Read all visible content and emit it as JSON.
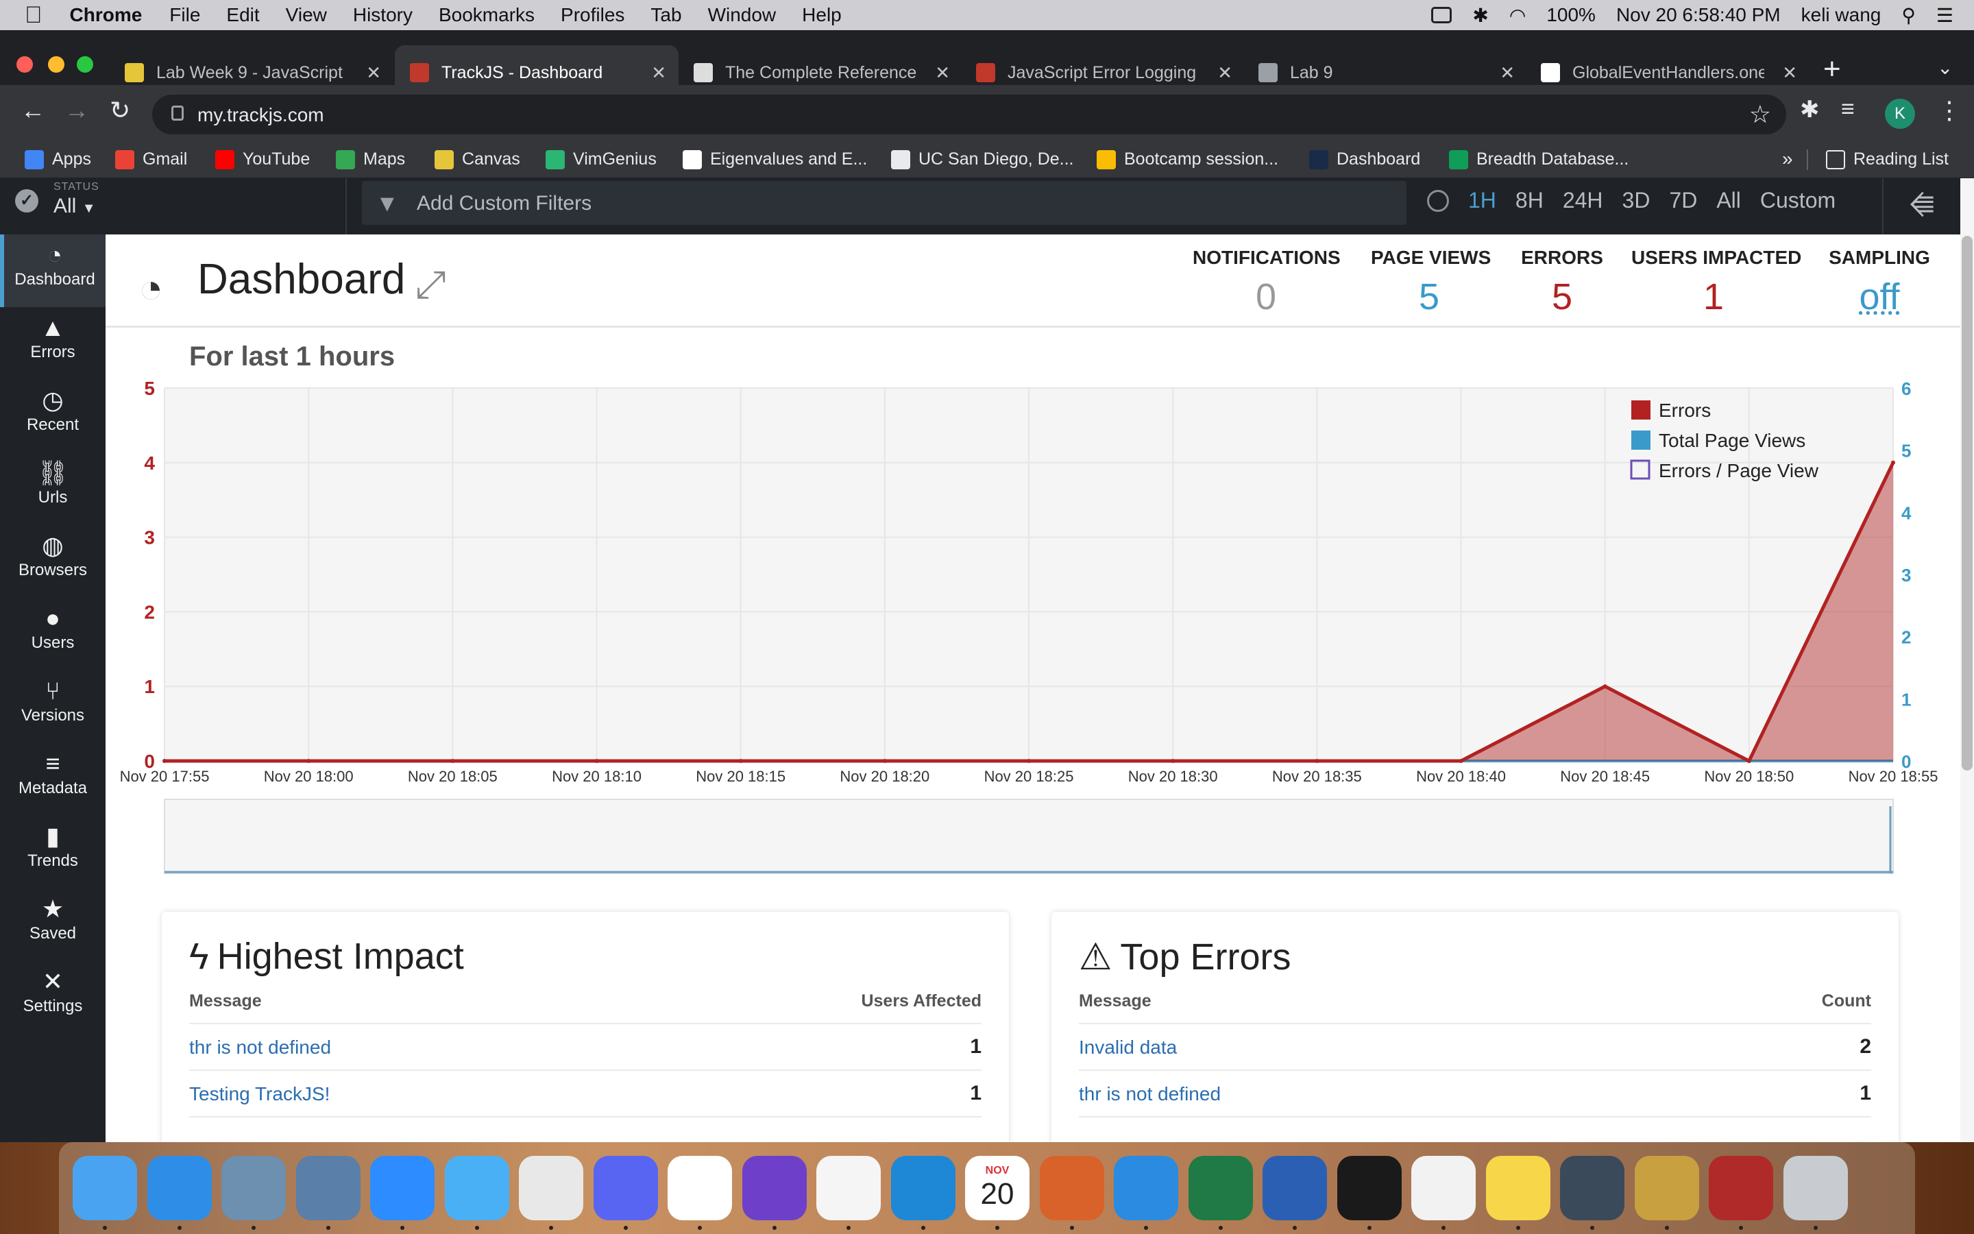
{
  "menubar": {
    "app_name": "Chrome",
    "menus": [
      "File",
      "Edit",
      "View",
      "History",
      "Bookmarks",
      "Profiles",
      "Tab",
      "Window",
      "Help"
    ],
    "battery": "100%",
    "datetime": "Nov 20  6:58:40 PM",
    "user": "keli wang"
  },
  "tabs": [
    {
      "title": "Lab Week 9 - JavaScript",
      "color": "#e5c63a",
      "active": false
    },
    {
      "title": "TrackJS - Dashboard",
      "color": "#c0392b",
      "active": true
    },
    {
      "title": "The Complete Reference",
      "color": "#ddd",
      "active": false
    },
    {
      "title": "JavaScript Error Logging",
      "color": "#c0392b",
      "active": false
    },
    {
      "title": "Lab 9",
      "color": "#9aa0a6",
      "active": false
    },
    {
      "title": "GlobalEventHandlers.one",
      "color": "#fff",
      "active": false
    }
  ],
  "address_bar": {
    "url": "my.trackjs.com"
  },
  "profile_initial": "K",
  "bookmarks": [
    {
      "label": "Apps",
      "color": "#4285f4"
    },
    {
      "label": "Gmail",
      "color": "#ea4335"
    },
    {
      "label": "YouTube",
      "color": "#ff0000"
    },
    {
      "label": "Maps",
      "color": "#34a853"
    },
    {
      "label": "Canvas",
      "color": "#e5c63a"
    },
    {
      "label": "VimGenius",
      "color": "#2bb673"
    },
    {
      "label": "Eigenvalues and E...",
      "color": "#fff"
    },
    {
      "label": "UC San Diego, De...",
      "color": "#e8eaed"
    },
    {
      "label": "Bootcamp session...",
      "color": "#fbbc04"
    },
    {
      "label": "Dashboard",
      "color": "#182b49"
    },
    {
      "label": "Breadth Database...",
      "color": "#0f9d58"
    }
  ],
  "reading_list": "Reading List",
  "filterbar": {
    "status_label": "STATUS",
    "status_value": "All",
    "filter_placeholder": "Add Custom Filters",
    "ranges": [
      "1H",
      "8H",
      "24H",
      "3D",
      "7D",
      "All",
      "Custom"
    ],
    "active_range": "1H"
  },
  "sidebar": [
    {
      "label": "Dashboard",
      "icon": "dashboard-icon",
      "glyph": "◔",
      "active": true
    },
    {
      "label": "Errors",
      "icon": "warning-icon",
      "glyph": "▲",
      "active": false
    },
    {
      "label": "Recent",
      "icon": "clock-icon",
      "glyph": "◷",
      "active": false
    },
    {
      "label": "Urls",
      "icon": "link-icon",
      "glyph": "⛓",
      "active": false
    },
    {
      "label": "Browsers",
      "icon": "globe-icon",
      "glyph": "◍",
      "active": false
    },
    {
      "label": "Users",
      "icon": "users-icon",
      "glyph": "●",
      "active": false
    },
    {
      "label": "Versions",
      "icon": "branch-icon",
      "glyph": "⑂",
      "active": false
    },
    {
      "label": "Metadata",
      "icon": "database-icon",
      "glyph": "≡",
      "active": false
    },
    {
      "label": "Trends",
      "icon": "bar-chart-icon",
      "glyph": "▮",
      "active": false
    },
    {
      "label": "Saved",
      "icon": "star-icon",
      "glyph": "★",
      "active": false
    },
    {
      "label": "Settings",
      "icon": "tools-icon",
      "glyph": "✕",
      "active": false
    }
  ],
  "dashboard": {
    "title": "Dashboard",
    "stats": [
      {
        "label": "NOTIFICATIONS",
        "value": "0",
        "color": "#999999"
      },
      {
        "label": "PAGE VIEWS",
        "value": "5",
        "color": "#3a9ac9"
      },
      {
        "label": "ERRORS",
        "value": "5",
        "color": "#b22222"
      },
      {
        "label": "USERS IMPACTED",
        "value": "1",
        "color": "#b22222"
      },
      {
        "label": "SAMPLING",
        "value": "off",
        "color": "#3a9ac9"
      }
    ],
    "range_label": "For last 1 hours"
  },
  "chart_data": {
    "type": "area",
    "x": [
      "Nov 20 17:55",
      "Nov 20 18:00",
      "Nov 20 18:05",
      "Nov 20 18:10",
      "Nov 20 18:15",
      "Nov 20 18:20",
      "Nov 20 18:25",
      "Nov 20 18:30",
      "Nov 20 18:35",
      "Nov 20 18:40",
      "Nov 20 18:45",
      "Nov 20 18:50",
      "Nov 20 18:55"
    ],
    "x_tick_labels": [
      "Nov 20 17:55",
      "Nov 20 18:00",
      "Nov 20 18:05",
      "Nov 20 18:10",
      "Nov 20 18:15",
      "Nov 20 18:20",
      "Nov 20 18:25",
      "Nov 20 18:30",
      "Nov 20 18:35",
      "Nov 20 18:40",
      "Nov 20 18:45",
      "Nov 20 18:50",
      "Nov 20 18:55"
    ],
    "series": [
      {
        "name": "Errors",
        "axis": "left",
        "color": "#b22222",
        "values": [
          0,
          0,
          0,
          0,
          0,
          0,
          0,
          0,
          0,
          0,
          1,
          0,
          4
        ]
      },
      {
        "name": "Total Page Views",
        "axis": "right",
        "color": "#3a9ac9",
        "values": [
          0,
          0,
          0,
          0,
          0,
          0,
          0,
          0,
          0,
          0,
          0,
          0,
          0
        ]
      },
      {
        "name": "Errors / Page View",
        "axis": "right",
        "color": "#6a4fb5",
        "values": []
      }
    ],
    "ylim_left": [
      0,
      5
    ],
    "yticks_left": [
      "0",
      "1",
      "2",
      "3",
      "4",
      "5"
    ],
    "ylim_right": [
      0,
      6
    ],
    "yticks_right": [
      "0",
      "1",
      "2",
      "3",
      "4",
      "5",
      "6"
    ],
    "legend_position": "top-right",
    "grid": true
  },
  "highest_impact": {
    "title": "Highest Impact",
    "col_message": "Message",
    "col_value": "Users Affected",
    "rows": [
      {
        "message": "thr is not defined",
        "value": "1"
      },
      {
        "message": "Testing TrackJS!",
        "value": "1"
      }
    ]
  },
  "top_errors": {
    "title": "Top Errors",
    "col_message": "Message",
    "col_value": "Count",
    "rows": [
      {
        "message": "Invalid data",
        "value": "2"
      },
      {
        "message": "thr is not defined",
        "value": "1"
      }
    ]
  },
  "dock": [
    {
      "name": "Finder",
      "color": "#4aa3f0"
    },
    {
      "name": "Safari",
      "color": "#2e8de6"
    },
    {
      "name": "Preview",
      "color": "#6d8fb0"
    },
    {
      "name": "Photos Viewer",
      "color": "#5a7fa8"
    },
    {
      "name": "Zoom",
      "color": "#2d8cff"
    },
    {
      "name": "Messages",
      "color": "#4ab0f5"
    },
    {
      "name": "Chrome",
      "color": "#e8e8e8"
    },
    {
      "name": "Discord",
      "color": "#5865f2"
    },
    {
      "name": "Slack",
      "color": "#ffffff"
    },
    {
      "name": "GitHub Desktop",
      "color": "#6e40c9"
    },
    {
      "name": "Photos",
      "color": "#f5f5f5"
    },
    {
      "name": "VS Code",
      "color": "#1e88d6"
    },
    {
      "name": "Calendar",
      "color": "#ffffff"
    },
    {
      "name": "MATLAB",
      "color": "#d9622b"
    },
    {
      "name": "App Store Preview",
      "color": "#2a8be0"
    },
    {
      "name": "Excel",
      "color": "#1f7a45"
    },
    {
      "name": "Word",
      "color": "#2b5fb4"
    },
    {
      "name": "Terminal",
      "color": "#1a1a1a"
    },
    {
      "name": "TextEdit",
      "color": "#f2f2f2"
    },
    {
      "name": "Notes",
      "color": "#f7d64a"
    },
    {
      "name": "QuickTime",
      "color": "#3a4a5a"
    },
    {
      "name": "Keychain",
      "color": "#c9a040"
    },
    {
      "name": "Photo Booth",
      "color": "#b02a2a"
    },
    {
      "name": "Trash",
      "color": "#c8ccd0"
    }
  ],
  "calendar_month": "NOV",
  "calendar_day": "20"
}
